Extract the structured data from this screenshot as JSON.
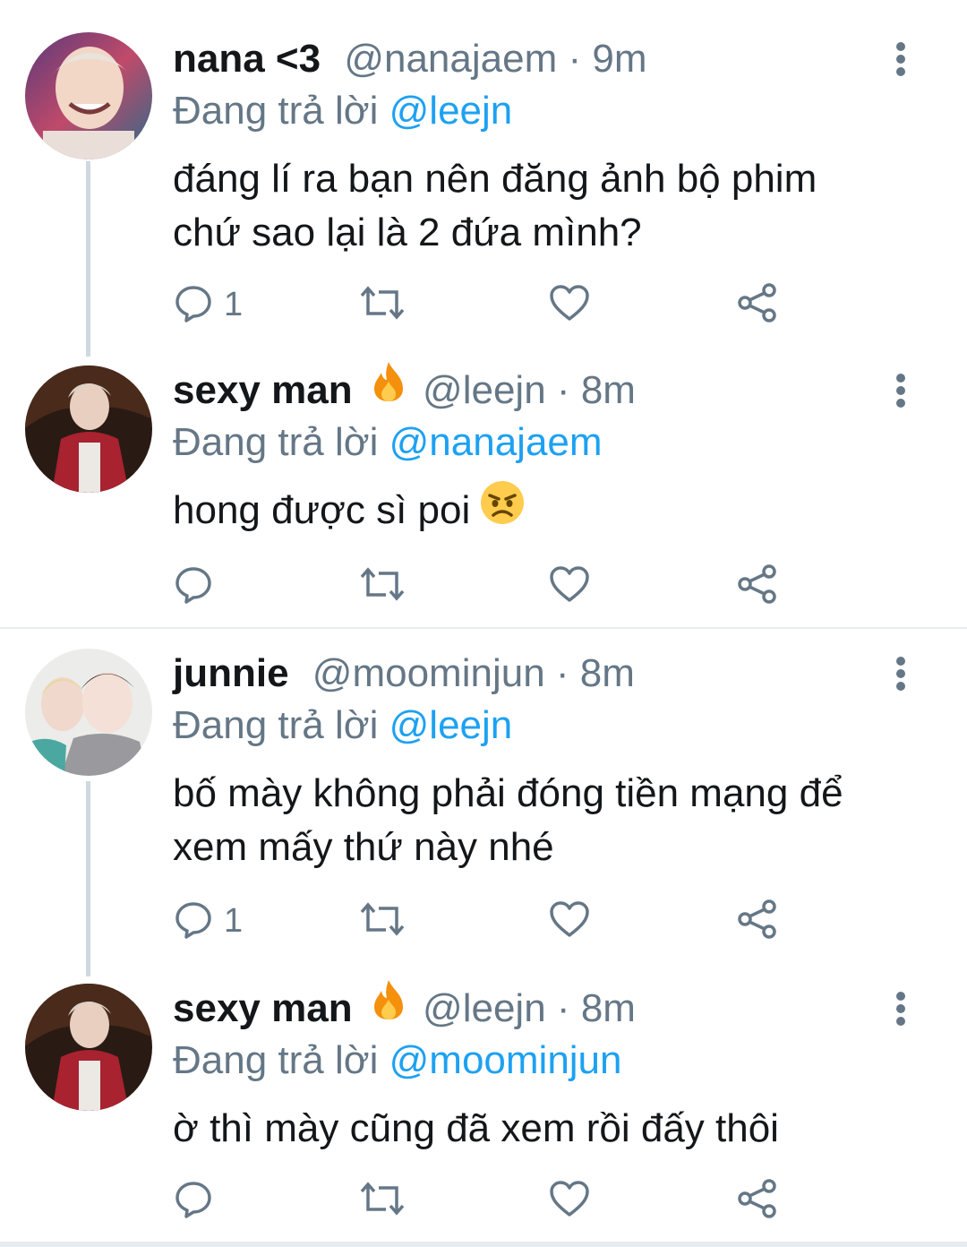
{
  "reply_prefix": "Đang trả lời",
  "tweets": [
    {
      "name": "nana <3",
      "handle": "@nanajaem",
      "dot": "·",
      "time": "9m",
      "reply_to": "@leejn",
      "text_line1": "đáng lí ra bạn nên đăng ảnh bộ phim",
      "text_line2": "chứ sao lại là 2 đứa mình?",
      "reply_count": "1"
    },
    {
      "name": "sexy man",
      "handle": "@leejn",
      "dot": "·",
      "time": "8m",
      "reply_to": "@nanajaem",
      "text_line1": "hong được sì poi",
      "reply_count": ""
    },
    {
      "name": "junnie",
      "handle": "@moominjun",
      "dot": "·",
      "time": "8m",
      "reply_to": "@leejn",
      "text_line1": "bố mày không phải đóng tiền mạng để",
      "text_line2": "xem mấy thứ này nhé",
      "reply_count": "1"
    },
    {
      "name": "sexy man",
      "handle": "@leejn",
      "dot": "·",
      "time": "8m",
      "reply_to": "@moominjun",
      "text_line1": "ờ thì mày cũng đã xem rồi đấy thôi",
      "reply_count": ""
    }
  ],
  "icons": {
    "reply": "reply-icon",
    "retweet": "retweet-icon",
    "like": "heart-icon",
    "share": "share-icon",
    "more": "more-vertical-icon",
    "fire": "fire-emoji",
    "angry": "angry-face-emoji"
  },
  "colors": {
    "text": "#14171a",
    "secondary": "#657786",
    "link": "#1da1f2",
    "thread_line": "#cfd9de",
    "divider": "#e6ecf0"
  }
}
